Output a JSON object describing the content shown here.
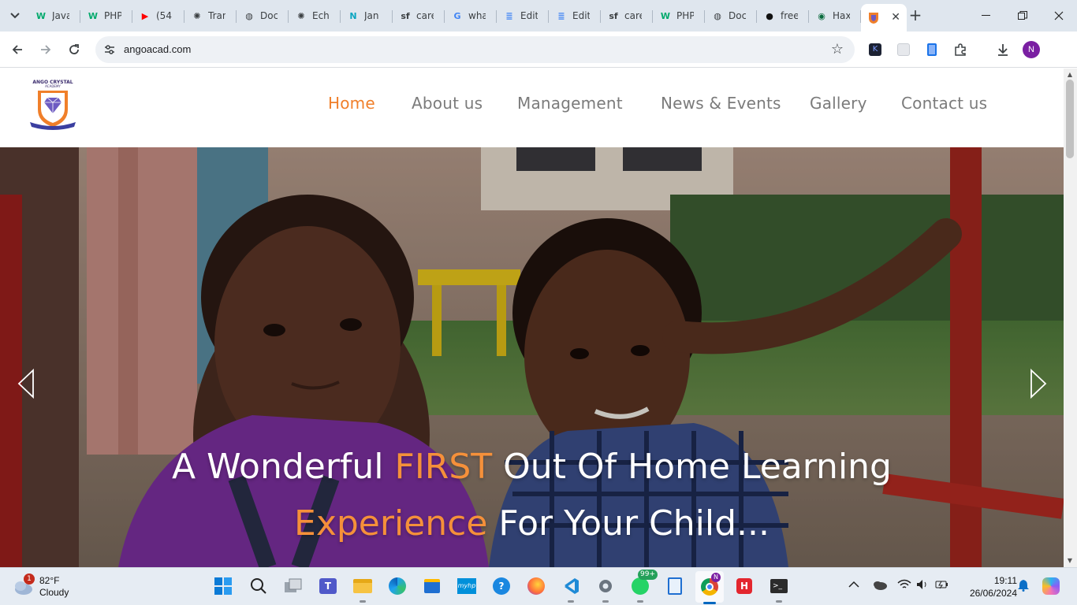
{
  "browser": {
    "tabs": [
      {
        "title": "Java",
        "icon": "w3schools-icon",
        "favicon_text": "W",
        "color": "#04aa6d"
      },
      {
        "title": "PHP",
        "icon": "w3schools-icon",
        "favicon_text": "W",
        "color": "#04aa6d"
      },
      {
        "title": "(54",
        "icon": "youtube-icon",
        "favicon_text": "▶",
        "color": "#ff0000"
      },
      {
        "title": "Tran",
        "icon": "chatgpt-icon",
        "favicon_text": "✺",
        "color": "#3c4043"
      },
      {
        "title": "Doc",
        "icon": "globe-icon",
        "favicon_text": "◍",
        "color": "#3c4043"
      },
      {
        "title": "Ech",
        "icon": "chatgpt-icon",
        "favicon_text": "✺",
        "color": "#3c4043"
      },
      {
        "title": "Jan",
        "icon": "jan-icon",
        "favicon_text": "N",
        "color": "#0aa5c0"
      },
      {
        "title": "care",
        "icon": "sf-icon",
        "favicon_text": "sf",
        "color": "#3c4043"
      },
      {
        "title": "wha",
        "icon": "google-icon",
        "favicon_text": "G",
        "color": "#4285f4"
      },
      {
        "title": "Edit",
        "icon": "google-docs-icon",
        "favicon_text": "≣",
        "color": "#4285f4"
      },
      {
        "title": "Edit",
        "icon": "google-docs-icon",
        "favicon_text": "≣",
        "color": "#4285f4"
      },
      {
        "title": "care",
        "icon": "sf-icon",
        "favicon_text": "sf",
        "color": "#3c4043"
      },
      {
        "title": "PHP",
        "icon": "w3schools-icon",
        "favicon_text": "W",
        "color": "#04aa6d"
      },
      {
        "title": "Doc",
        "icon": "globe-icon",
        "favicon_text": "◍",
        "color": "#3c4043"
      },
      {
        "title": "free",
        "icon": "github-icon",
        "favicon_text": "●",
        "color": "#111111"
      },
      {
        "title": "Hax",
        "icon": "eye-icon",
        "favicon_text": "◉",
        "color": "#0a6b3d"
      }
    ],
    "active_tab": {
      "title": "",
      "icon": "ango-crystal-favicon"
    },
    "address": "angoacad.com",
    "profile_initial": "N"
  },
  "site": {
    "logo_text": "ANGO CRYSTAL ACADEMY",
    "nav": [
      "Home",
      "About us",
      "Management",
      "News & Events",
      "Gallery",
      "Contact us"
    ],
    "active_nav": "Home",
    "hero": {
      "line1_pre": "A Wonderful ",
      "line1_highlight": "FIRST",
      "line1_post": " Out Of Home Learning",
      "line2_highlight": "Experience",
      "line2_post": " For Your Child..."
    },
    "colors": {
      "accent": "#f07f2a",
      "nav_text": "#7b7b7b"
    }
  },
  "taskbar": {
    "weather": {
      "temp": "82°F",
      "condition": "Cloudy",
      "badge": "1"
    },
    "whatsapp_badge": "99+",
    "chrome_profile_badge": "N",
    "time": "19:11",
    "date": "26/06/2024"
  }
}
